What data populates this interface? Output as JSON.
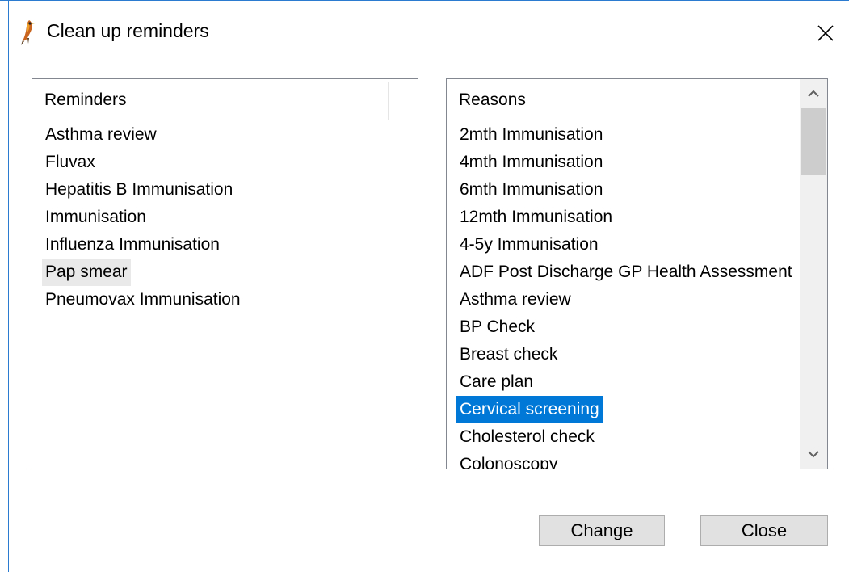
{
  "window": {
    "title": "Clean up reminders",
    "app_icon": "bird-icon",
    "close_icon": "close-icon"
  },
  "reminders": {
    "header": "Reminders",
    "items": [
      "Asthma review",
      "Fluvax",
      "Hepatitis B Immunisation",
      "Immunisation",
      "Influenza Immunisation",
      "Pap smear",
      "Pneumovax Immunisation"
    ],
    "hovered_item": "Pap smear"
  },
  "reasons": {
    "header": "Reasons",
    "items": [
      "2mth Immunisation",
      "4mth Immunisation",
      "6mth Immunisation",
      "12mth Immunisation",
      "4-5y Immunisation",
      "ADF Post Discharge GP Health Assessment",
      "Asthma review",
      "BP Check",
      "Breast check",
      "Care plan",
      "Cervical screening",
      "Cholesterol check",
      "Colonoscopy"
    ],
    "selected_item": "Cervical screening",
    "scroll_up_icon": "chevron-up-icon",
    "scroll_down_icon": "chevron-down-icon"
  },
  "buttons": {
    "change_label": "Change",
    "close_label": "Close"
  },
  "colors": {
    "selection": "#0078d7",
    "window_accent": "#2b7bd1"
  }
}
